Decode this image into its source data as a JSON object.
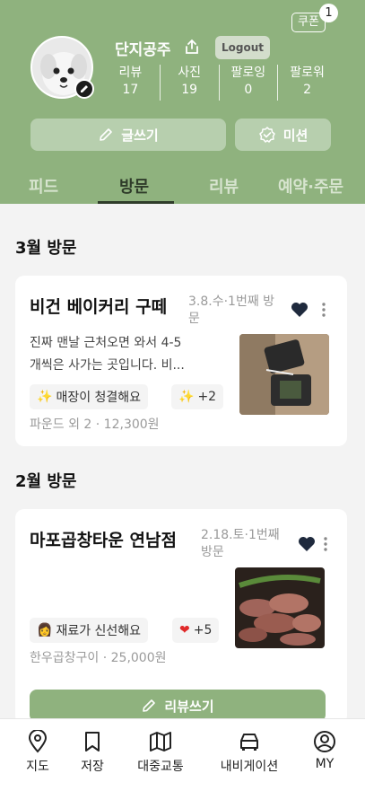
{
  "header": {
    "coupon_label": "쿠폰",
    "coupon_count": "1",
    "username": "단지공주",
    "logout_label": "Logout",
    "stats": [
      {
        "label": "리뷰",
        "value": "17"
      },
      {
        "label": "사진",
        "value": "19"
      },
      {
        "label": "팔로잉",
        "value": "0"
      },
      {
        "label": "팔로워",
        "value": "2"
      }
    ],
    "write_label": "글쓰기",
    "mission_label": "미션"
  },
  "tabs": [
    "피드",
    "방문",
    "리뷰",
    "예약·주문"
  ],
  "active_tab": "방문",
  "sections": [
    {
      "title": "3월 방문",
      "card": {
        "place": "비건 베이커리 구떼",
        "meta_line1": "3.8.수·1번째 방",
        "meta_line2": "문",
        "desc_line1": "진짜 맨날 근처오면 와서 4-5",
        "desc_line2": "개씩은 사가는 곳입니다. 비...",
        "chip_text": "매장이 청결해요",
        "chip_more": "+2",
        "footer": "파운드 외 2 · 12,300원"
      }
    },
    {
      "title": "2월 방문",
      "card": {
        "place": "마포곱창타운 연남점",
        "meta_line1": "2.18.토·1번째",
        "meta_line2": "방문",
        "chip_text": "재료가 신선해요",
        "chip_more": "+5",
        "footer": "한우곱창구이 · 25,000원",
        "review_button": "리뷰쓰기"
      }
    }
  ],
  "bottom_nav": [
    {
      "label": "지도",
      "icon": "map-pin-icon"
    },
    {
      "label": "저장",
      "icon": "bookmark-icon"
    },
    {
      "label": "대중교통",
      "icon": "transit-map-icon"
    },
    {
      "label": "내비게이션",
      "icon": "car-icon"
    },
    {
      "label": "MY",
      "icon": "user-icon"
    }
  ],
  "colors": {
    "brand_green": "#8fb27e",
    "button_light_green": "#b7cfae",
    "tab_active": "#2f3c2a",
    "heart": "#1f2a3d"
  }
}
